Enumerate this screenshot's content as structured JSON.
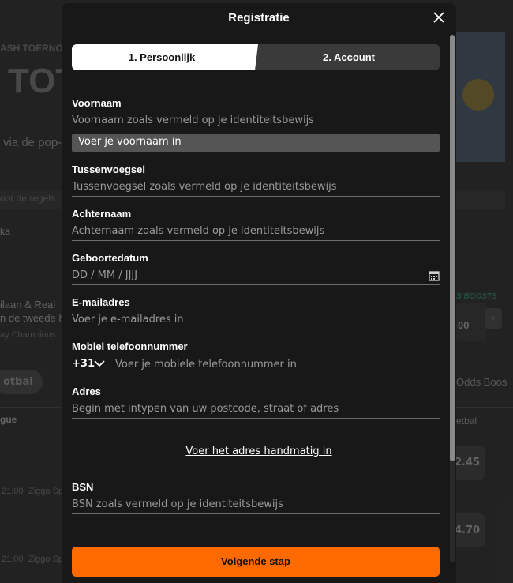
{
  "background": {
    "banner_top": "ASH TOERNO",
    "banner_big": "TOT",
    "promo_text": "via de pop-",
    "rules_text": "oor de regels",
    "section_text": "ka",
    "match_line1": "ilaan & Real",
    "match_line2": "n de tweede h",
    "match_line3": "ay Champions",
    "boosts_label": "S BOOSTS",
    "boost_value": "00",
    "pill_football": "otbal",
    "odds_boost": "Odds Boos",
    "league": "gue",
    "football_right": "etbal",
    "time1": "21:00",
    "channel1": "Ziggo Sp",
    "time2": "21:00",
    "channel2": "Ziggo Sp",
    "odd1": "2.45",
    "odd2": "4.70"
  },
  "modal": {
    "title": "Registratie",
    "close_icon": "close-icon",
    "steps": [
      {
        "label": "1. Persoonlijk"
      },
      {
        "label": "2. Account"
      }
    ],
    "fields": {
      "first_name": {
        "label": "Voornaam",
        "placeholder": "Voornaam zoals vermeld op je identiteitsbewijs",
        "tooltip": "Voer je voornaam in"
      },
      "middle_name": {
        "label": "Tussenvoegsel",
        "placeholder": "Tussenvoegsel zoals vermeld op je identiteitsbewijs"
      },
      "last_name": {
        "label": "Achternaam",
        "placeholder": "Achternaam zoals vermeld op je identiteitsbewijs"
      },
      "birth_date": {
        "label": "Geboortedatum",
        "placeholder": "DD / MM / JJJJ"
      },
      "email": {
        "label": "E-mailadres",
        "placeholder": "Voer je e-mailadres in"
      },
      "phone": {
        "label": "Mobiel telefoonnummer",
        "prefix": "+31",
        "placeholder": "Voer je mobiele telefoonnummer in"
      },
      "address": {
        "label": "Adres",
        "placeholder": "Begin met intypen van uw postcode, straat of adres"
      },
      "bsn": {
        "label": "BSN",
        "placeholder": "BSN zoals vermeld op je identiteitsbewijs"
      }
    },
    "manual_address_link": "Voer het adres handmatig in",
    "next_button": "Volgende stap"
  },
  "colors": {
    "accent": "#ff6a00",
    "modal_bg": "#181818"
  }
}
